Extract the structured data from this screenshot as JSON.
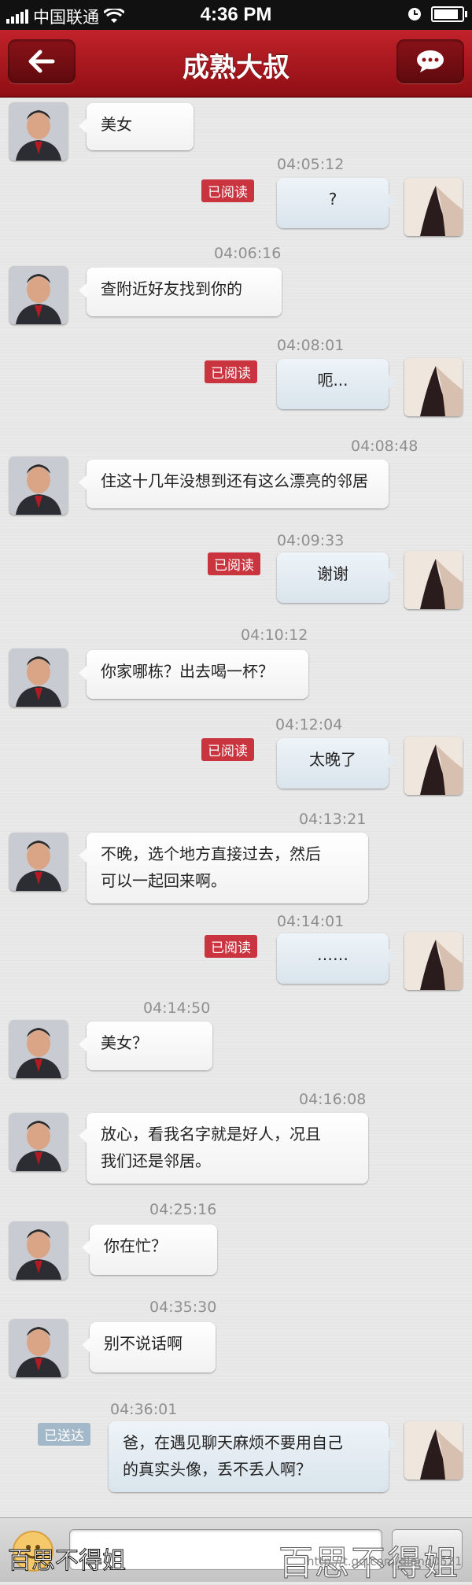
{
  "status_bar": {
    "carrier": "中国联通",
    "time": "4:36 PM"
  },
  "header": {
    "title": "成熟大叔",
    "back_icon": "back-arrow-icon",
    "message_icon": "chat-bubble-icon"
  },
  "messages": [
    {
      "side": "in",
      "lines": [
        "美女"
      ]
    },
    {
      "time": "04:05:12",
      "side": "out",
      "status": "已阅读",
      "lines": [
        "?"
      ]
    },
    {
      "time": "04:06:16",
      "side": "in",
      "lines": [
        "查附近好友找到你的"
      ]
    },
    {
      "time": "04:08:01",
      "side": "out",
      "status": "已阅读",
      "lines": [
        "呃..."
      ]
    },
    {
      "time": "04:08:48",
      "side": "in",
      "lines": [
        "住这十几年没想到还有这么漂亮的邻居"
      ]
    },
    {
      "time": "04:09:33",
      "side": "out",
      "status": "已阅读",
      "lines": [
        "谢谢"
      ]
    },
    {
      "time": "04:10:12",
      "side": "in",
      "lines": [
        "你家哪栋？出去喝一杯？"
      ]
    },
    {
      "time": "04:12:04",
      "side": "out",
      "status": "已阅读",
      "lines": [
        "太晚了"
      ]
    },
    {
      "time": "04:13:21",
      "side": "in",
      "lines": [
        "不晚，选个地方直接过去，然后",
        "可以一起回来啊。"
      ]
    },
    {
      "time": "04:14:01",
      "side": "out",
      "status": "已阅读",
      "lines": [
        "……"
      ]
    },
    {
      "time": "04:14:50",
      "side": "in",
      "lines": [
        "美女？"
      ]
    },
    {
      "time": "04:16:08",
      "side": "in",
      "lines": [
        "放心，看我名字就是好人，况且",
        "我们还是邻居。"
      ]
    },
    {
      "time": "04:25:16",
      "side": "in",
      "lines": [
        "你在忙？"
      ]
    },
    {
      "time": "04:35:30",
      "side": "in",
      "lines": [
        "别不说话啊"
      ]
    },
    {
      "time": "04:36:01",
      "side": "out",
      "status": "已送达",
      "lines": [
        "爸，在遇见聊天麻烦不要用自己",
        "的真实头像，丢不丢人啊？"
      ]
    }
  ],
  "bottom_bar": {
    "emoji_icon": "smiley-icon"
  },
  "watermark": {
    "left_text": "百思不得姐",
    "right_text": "百思不得姐",
    "url": "http://t.qq.com/dieng0521"
  }
}
